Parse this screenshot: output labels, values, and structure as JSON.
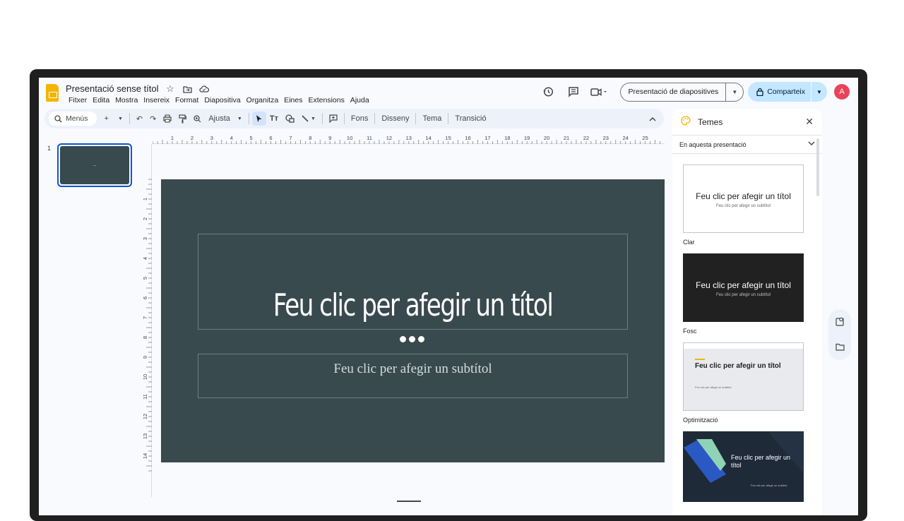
{
  "header": {
    "doc_title": "Presentació sense títol",
    "menu": [
      "Fitxer",
      "Edita",
      "Mostra",
      "Insereix",
      "Format",
      "Diapositiva",
      "Organitza",
      "Eines",
      "Extensions",
      "Ajuda"
    ],
    "present_label": "Presentació de diapositives",
    "share_label": "Comparteix",
    "avatar_letter": "A"
  },
  "toolbar": {
    "menus_label": "Menús",
    "zoom_label": "Ajusta",
    "background_label": "Fons",
    "layout_label": "Disseny",
    "theme_label": "Tema",
    "transition_label": "Transició"
  },
  "filmstrip": {
    "slide_number": "1",
    "thumb_text": "..."
  },
  "slide": {
    "title": "Feu clic per afegir un títol",
    "subtitle": "Feu clic per afegir un subtítol",
    "background": "#394a4f"
  },
  "ruler": {
    "top_ticks": [
      "1",
      "2",
      "3",
      "4",
      "5",
      "6",
      "7",
      "8",
      "9",
      "10",
      "11",
      "12",
      "13",
      "14",
      "15",
      "16",
      "17",
      "18",
      "19",
      "20",
      "21",
      "22",
      "23",
      "24",
      "25"
    ],
    "left_ticks": [
      "1",
      "2",
      "3",
      "4",
      "5",
      "6",
      "7",
      "8",
      "9",
      "10",
      "11",
      "12",
      "13",
      "14"
    ]
  },
  "themes_panel": {
    "title": "Temes",
    "dropdown": "En aquesta presentació",
    "themes": [
      {
        "label": "Clar",
        "title": "Feu clic per afegir un títol",
        "subtitle": "Feu clic per afegir un subtítol"
      },
      {
        "label": "Fosc",
        "title": "Feu clic per afegir un títol",
        "subtitle": "Feu clic per afegir un subtítol"
      },
      {
        "label": "Optimització",
        "title": "Feu clic per afegir un títol",
        "subtitle": "Feu clic per afegir un subtítol"
      },
      {
        "label": "",
        "title": "Feu clic per afegir un títol",
        "subtitle": "Feu clic per afegir un subtítol"
      }
    ]
  },
  "colors": {
    "accent": "#0b57d0",
    "share_bg": "#c2e7ff",
    "avatar": "#e8435a"
  }
}
